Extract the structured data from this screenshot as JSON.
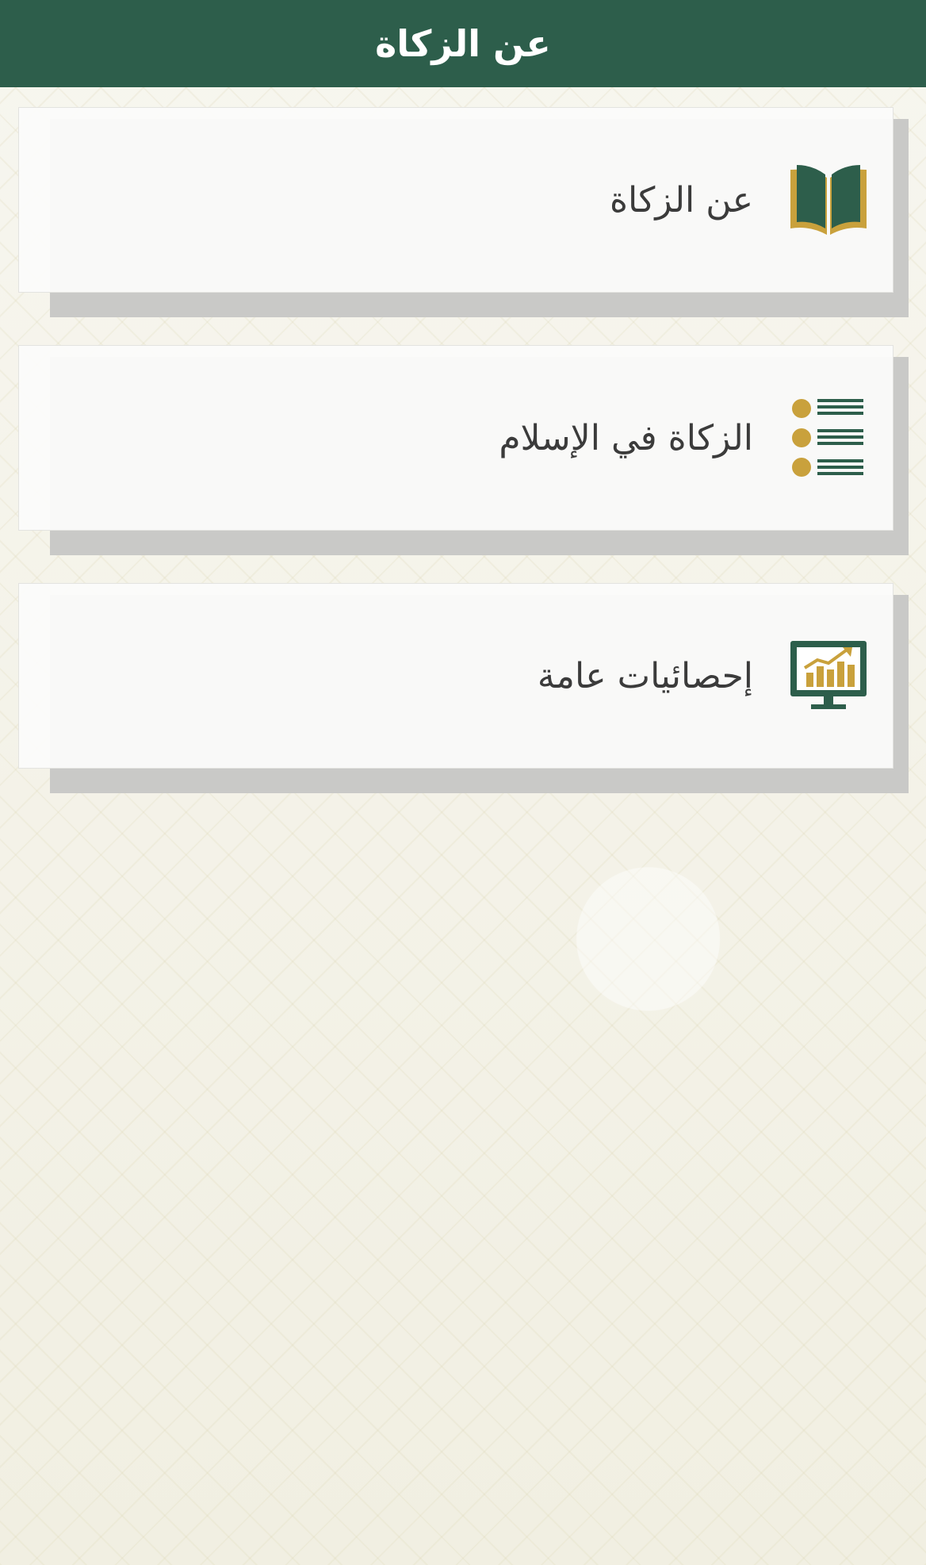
{
  "header": {
    "title": "عن الزكاة"
  },
  "menu": {
    "items": [
      {
        "label": "عن الزكاة",
        "icon": "open-book-icon"
      },
      {
        "label": "الزكاة في الإسلام",
        "icon": "bullet-list-icon"
      },
      {
        "label": "إحصائيات عامة",
        "icon": "statistics-monitor-icon"
      }
    ]
  },
  "colors": {
    "header_bg": "#2d5e4b",
    "accent_gold": "#c9a13c",
    "accent_green": "#2d5e4b"
  }
}
